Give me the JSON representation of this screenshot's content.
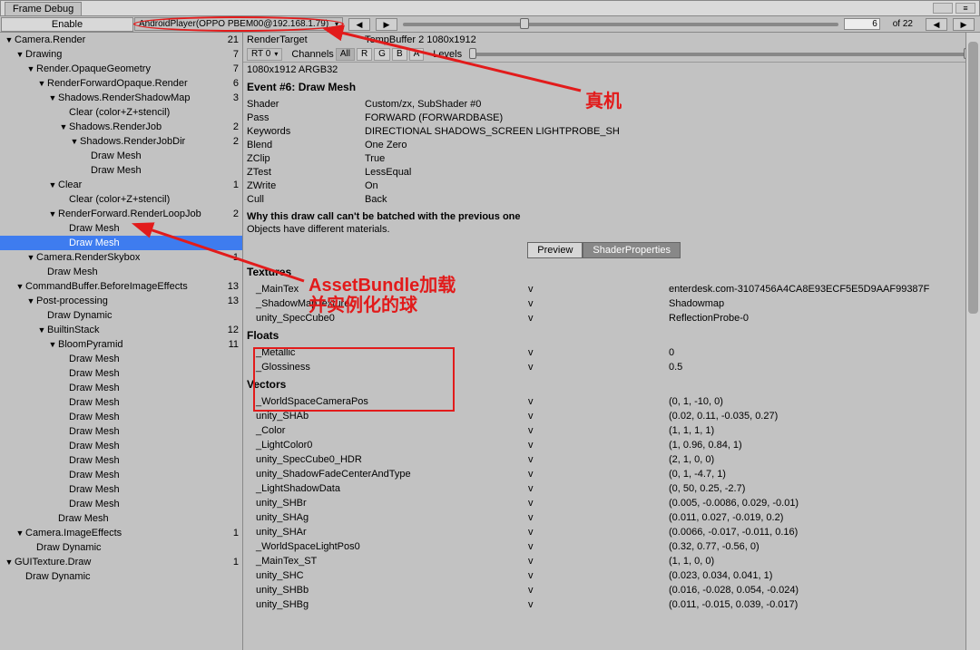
{
  "window": {
    "title": "Frame Debug"
  },
  "toolbar": {
    "enable": "Enable",
    "player": "AndroidPlayer(OPPO PBEM00@192.168.1.79)",
    "frame_current": "6",
    "frame_total": "of 22"
  },
  "tree": [
    {
      "depth": 0,
      "arrow": "▼",
      "label": "Camera.Render",
      "count": "21"
    },
    {
      "depth": 1,
      "arrow": "▼",
      "label": "Drawing",
      "count": "7"
    },
    {
      "depth": 2,
      "arrow": "▼",
      "label": "Render.OpaqueGeometry",
      "count": "7"
    },
    {
      "depth": 3,
      "arrow": "▼",
      "label": "RenderForwardOpaque.Render",
      "count": "6"
    },
    {
      "depth": 4,
      "arrow": "▼",
      "label": "Shadows.RenderShadowMap",
      "count": "3"
    },
    {
      "depth": 5,
      "arrow": "",
      "label": "Clear (color+Z+stencil)",
      "count": ""
    },
    {
      "depth": 5,
      "arrow": "▼",
      "label": "Shadows.RenderJob",
      "count": "2"
    },
    {
      "depth": 6,
      "arrow": "▼",
      "label": "Shadows.RenderJobDir",
      "count": "2"
    },
    {
      "depth": 7,
      "arrow": "",
      "label": "Draw Mesh",
      "count": ""
    },
    {
      "depth": 7,
      "arrow": "",
      "label": "Draw Mesh",
      "count": ""
    },
    {
      "depth": 4,
      "arrow": "▼",
      "label": "Clear",
      "count": "1"
    },
    {
      "depth": 5,
      "arrow": "",
      "label": "Clear (color+Z+stencil)",
      "count": ""
    },
    {
      "depth": 4,
      "arrow": "▼",
      "label": "RenderForward.RenderLoopJob",
      "count": "2"
    },
    {
      "depth": 5,
      "arrow": "",
      "label": "Draw Mesh",
      "count": ""
    },
    {
      "depth": 5,
      "arrow": "",
      "label": "Draw Mesh",
      "count": "",
      "selected": true
    },
    {
      "depth": 2,
      "arrow": "▼",
      "label": "Camera.RenderSkybox",
      "count": "1"
    },
    {
      "depth": 3,
      "arrow": "",
      "label": "Draw Mesh",
      "count": ""
    },
    {
      "depth": 1,
      "arrow": "▼",
      "label": "CommandBuffer.BeforeImageEffects",
      "count": "13"
    },
    {
      "depth": 2,
      "arrow": "▼",
      "label": "Post-processing",
      "count": "13"
    },
    {
      "depth": 3,
      "arrow": "",
      "label": "Draw Dynamic",
      "count": ""
    },
    {
      "depth": 3,
      "arrow": "▼",
      "label": "BuiltinStack",
      "count": "12"
    },
    {
      "depth": 4,
      "arrow": "▼",
      "label": "BloomPyramid",
      "count": "11"
    },
    {
      "depth": 5,
      "arrow": "",
      "label": "Draw Mesh",
      "count": ""
    },
    {
      "depth": 5,
      "arrow": "",
      "label": "Draw Mesh",
      "count": ""
    },
    {
      "depth": 5,
      "arrow": "",
      "label": "Draw Mesh",
      "count": ""
    },
    {
      "depth": 5,
      "arrow": "",
      "label": "Draw Mesh",
      "count": ""
    },
    {
      "depth": 5,
      "arrow": "",
      "label": "Draw Mesh",
      "count": ""
    },
    {
      "depth": 5,
      "arrow": "",
      "label": "Draw Mesh",
      "count": ""
    },
    {
      "depth": 5,
      "arrow": "",
      "label": "Draw Mesh",
      "count": ""
    },
    {
      "depth": 5,
      "arrow": "",
      "label": "Draw Mesh",
      "count": ""
    },
    {
      "depth": 5,
      "arrow": "",
      "label": "Draw Mesh",
      "count": ""
    },
    {
      "depth": 5,
      "arrow": "",
      "label": "Draw Mesh",
      "count": ""
    },
    {
      "depth": 5,
      "arrow": "",
      "label": "Draw Mesh",
      "count": ""
    },
    {
      "depth": 4,
      "arrow": "",
      "label": "Draw Mesh",
      "count": ""
    },
    {
      "depth": 1,
      "arrow": "▼",
      "label": "Camera.ImageEffects",
      "count": "1"
    },
    {
      "depth": 2,
      "arrow": "",
      "label": "Draw Dynamic",
      "count": ""
    },
    {
      "depth": 0,
      "arrow": "▼",
      "label": "GUITexture.Draw",
      "count": "1"
    },
    {
      "depth": 1,
      "arrow": "",
      "label": "Draw Dynamic",
      "count": ""
    }
  ],
  "detail": {
    "render_target_label": "RenderTarget",
    "render_target_value": "TempBuffer 2 1080x1912",
    "rt_dropdown": "RT 0",
    "channels_label": "Channels",
    "channels": [
      "All",
      "R",
      "G",
      "B",
      "A"
    ],
    "levels_label": "Levels",
    "dimensions": "1080x1912 ARGB32",
    "event_title": "Event #6: Draw Mesh",
    "props": [
      {
        "k": "Shader",
        "v": "Custom/zx, SubShader #0"
      },
      {
        "k": "Pass",
        "v": "FORWARD (FORWARDBASE)"
      },
      {
        "k": "Keywords",
        "v": "DIRECTIONAL SHADOWS_SCREEN LIGHTPROBE_SH"
      },
      {
        "k": "Blend",
        "v": "One Zero"
      },
      {
        "k": "ZClip",
        "v": "True"
      },
      {
        "k": "ZTest",
        "v": "LessEqual"
      },
      {
        "k": "ZWrite",
        "v": "On"
      },
      {
        "k": "Cull",
        "v": "Back"
      }
    ],
    "batch_title": "Why this draw call can't be batched with the previous one",
    "batch_reason": "Objects have different materials.",
    "tabs": {
      "preview": "Preview",
      "shader": "ShaderProperties"
    },
    "sections": {
      "textures": "Textures",
      "floats": "Floats",
      "vectors": "Vectors"
    },
    "textures": [
      {
        "name": "_MainTex",
        "v": "v",
        "val": "enterdesk.com-3107456A4CA8E93ECF5E5D9AAF99387F"
      },
      {
        "name": "_ShadowMapTexture",
        "v": "v",
        "val": "Shadowmap"
      },
      {
        "name": "unity_SpecCube0",
        "v": "v",
        "val": "ReflectionProbe-0"
      }
    ],
    "floats": [
      {
        "name": "_Metallic",
        "v": "v",
        "val": "0"
      },
      {
        "name": "_Glossiness",
        "v": "v",
        "val": "0.5"
      }
    ],
    "vectors": [
      {
        "name": "_WorldSpaceCameraPos",
        "v": "v",
        "val": "(0, 1, -10, 0)"
      },
      {
        "name": "unity_SHAb",
        "v": "v",
        "val": "(0.02, 0.11, -0.035, 0.27)"
      },
      {
        "name": "_Color",
        "v": "v",
        "val": "(1, 1, 1, 1)"
      },
      {
        "name": "_LightColor0",
        "v": "v",
        "val": "(1, 0.96, 0.84, 1)"
      },
      {
        "name": "unity_SpecCube0_HDR",
        "v": "v",
        "val": "(2, 1, 0, 0)"
      },
      {
        "name": "unity_ShadowFadeCenterAndType",
        "v": "v",
        "val": "(0, 1, -4.7, 1)"
      },
      {
        "name": "_LightShadowData",
        "v": "v",
        "val": "(0, 50, 0.25, -2.7)"
      },
      {
        "name": "unity_SHBr",
        "v": "v",
        "val": "(0.005, -0.0086, 0.029, -0.01)"
      },
      {
        "name": "unity_SHAg",
        "v": "v",
        "val": "(0.011, 0.027, -0.019, 0.2)"
      },
      {
        "name": "unity_SHAr",
        "v": "v",
        "val": "(0.0066, -0.017, -0.011, 0.16)"
      },
      {
        "name": "_WorldSpaceLightPos0",
        "v": "v",
        "val": "(0.32, 0.77, -0.56, 0)"
      },
      {
        "name": "_MainTex_ST",
        "v": "v",
        "val": "(1, 1, 0, 0)"
      },
      {
        "name": "unity_SHC",
        "v": "v",
        "val": "(0.023, 0.034, 0.041, 1)"
      },
      {
        "name": "unity_SHBb",
        "v": "v",
        "val": "(0.016, -0.028, 0.054, -0.024)"
      },
      {
        "name": "unity_SHBg",
        "v": "v",
        "val": "(0.011, -0.015, 0.039, -0.017)"
      }
    ]
  },
  "annotations": {
    "real_device": "真机",
    "assetbundle1": "AssetBundle加载",
    "assetbundle2": "并实例化的球"
  }
}
